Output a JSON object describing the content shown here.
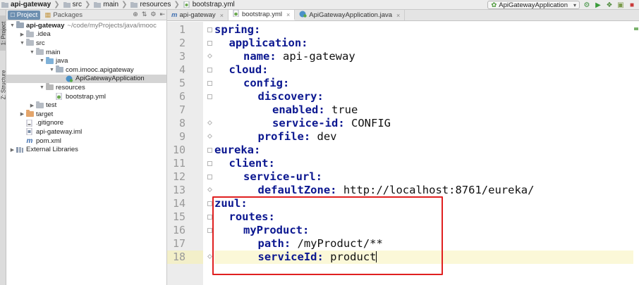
{
  "breadcrumb": [
    {
      "label": "api-gateway",
      "icon": "folder-icon",
      "bold": true
    },
    {
      "label": "src",
      "icon": "folder-icon",
      "bold": false
    },
    {
      "label": "main",
      "icon": "folder-icon",
      "bold": false
    },
    {
      "label": "resources",
      "icon": "folder-icon",
      "bold": false
    },
    {
      "label": "bootstrap.yml",
      "icon": "yaml-file-icon",
      "bold": false
    }
  ],
  "run": {
    "config_label": "ApiGatewayApplication",
    "icons": [
      "build-icon",
      "run-icon",
      "debug-icon",
      "coverage-icon",
      "stop-icon"
    ]
  },
  "leftstrip": {
    "project_tab": "1: Project",
    "structure_tab": "Z: Structure"
  },
  "project_panel": {
    "tabs": [
      "Project",
      "Packages"
    ],
    "tree": [
      {
        "label": "api-gateway",
        "path": "~/code/myProjects/java/imooc",
        "depth": 0,
        "twisty": "open",
        "icon": "module-folder",
        "bold": true
      },
      {
        "label": ".idea",
        "depth": 1,
        "twisty": "closed",
        "icon": "folder"
      },
      {
        "label": "src",
        "depth": 1,
        "twisty": "open",
        "icon": "folder"
      },
      {
        "label": "main",
        "depth": 2,
        "twisty": "open",
        "icon": "folder"
      },
      {
        "label": "java",
        "depth": 3,
        "twisty": "open",
        "icon": "folder-blue"
      },
      {
        "label": "com.imooc.apigateway",
        "depth": 4,
        "twisty": "open",
        "icon": "package"
      },
      {
        "label": "ApiGatewayApplication",
        "depth": 5,
        "twisty": "none",
        "icon": "spring-class",
        "selected": true
      },
      {
        "label": "resources",
        "depth": 3,
        "twisty": "open",
        "icon": "folder-res"
      },
      {
        "label": "bootstrap.yml",
        "depth": 4,
        "twisty": "none",
        "icon": "yaml"
      },
      {
        "label": "test",
        "depth": 2,
        "twisty": "closed",
        "icon": "folder"
      },
      {
        "label": "target",
        "depth": 1,
        "twisty": "closed",
        "icon": "folder-orange"
      },
      {
        "label": ".gitignore",
        "depth": 1,
        "twisty": "none",
        "icon": "file"
      },
      {
        "label": "api-gateway.iml",
        "depth": 1,
        "twisty": "none",
        "icon": "iml"
      },
      {
        "label": "pom.xml",
        "depth": 1,
        "twisty": "none",
        "icon": "maven"
      },
      {
        "label": "External Libraries",
        "depth": 0,
        "twisty": "closed",
        "icon": "libraries"
      }
    ]
  },
  "editor_tabs": [
    {
      "label": "api-gateway",
      "icon": "maven-icon",
      "active": false
    },
    {
      "label": "bootstrap.yml",
      "icon": "yaml-file-icon",
      "active": true
    },
    {
      "label": "ApiGatewayApplication.java",
      "icon": "class-icon",
      "active": false
    }
  ],
  "editor": {
    "current_line": 18,
    "lines": [
      {
        "n": "1",
        "indent": 0,
        "key": "spring:",
        "value": ""
      },
      {
        "n": "2",
        "indent": 1,
        "key": "application:",
        "value": ""
      },
      {
        "n": "3",
        "indent": 2,
        "key": "name:",
        "value": " api-gateway"
      },
      {
        "n": "4",
        "indent": 1,
        "key": "cloud:",
        "value": ""
      },
      {
        "n": "5",
        "indent": 2,
        "key": "config:",
        "value": ""
      },
      {
        "n": "6",
        "indent": 3,
        "key": "discovery:",
        "value": ""
      },
      {
        "n": "7",
        "indent": 4,
        "key": "enabled:",
        "value": " true"
      },
      {
        "n": "8",
        "indent": 4,
        "key": "service-id:",
        "value": " CONFIG"
      },
      {
        "n": "9",
        "indent": 3,
        "key": "profile:",
        "value": " dev"
      },
      {
        "n": "10",
        "indent": 0,
        "key": "eureka:",
        "value": ""
      },
      {
        "n": "11",
        "indent": 1,
        "key": "client:",
        "value": ""
      },
      {
        "n": "12",
        "indent": 2,
        "key": "service-url:",
        "value": ""
      },
      {
        "n": "13",
        "indent": 3,
        "key": "defaultZone:",
        "value": " http://localhost:8761/eureka/"
      },
      {
        "n": "14",
        "indent": 0,
        "key": "zuul:",
        "value": ""
      },
      {
        "n": "15",
        "indent": 1,
        "key": "routes:",
        "value": ""
      },
      {
        "n": "16",
        "indent": 2,
        "key": "myProduct:",
        "value": ""
      },
      {
        "n": "17",
        "indent": 3,
        "key": "path:",
        "value": " /myProduct/**"
      },
      {
        "n": "18",
        "indent": 3,
        "key": "serviceId:",
        "value": " product"
      }
    ]
  },
  "colors": {
    "key": "#0b1790",
    "highlight_box": "#e02020",
    "current_line": "#fbf8d8",
    "selected_row": "#d4d4d4",
    "active_project_tab": "#6d8fb0"
  }
}
